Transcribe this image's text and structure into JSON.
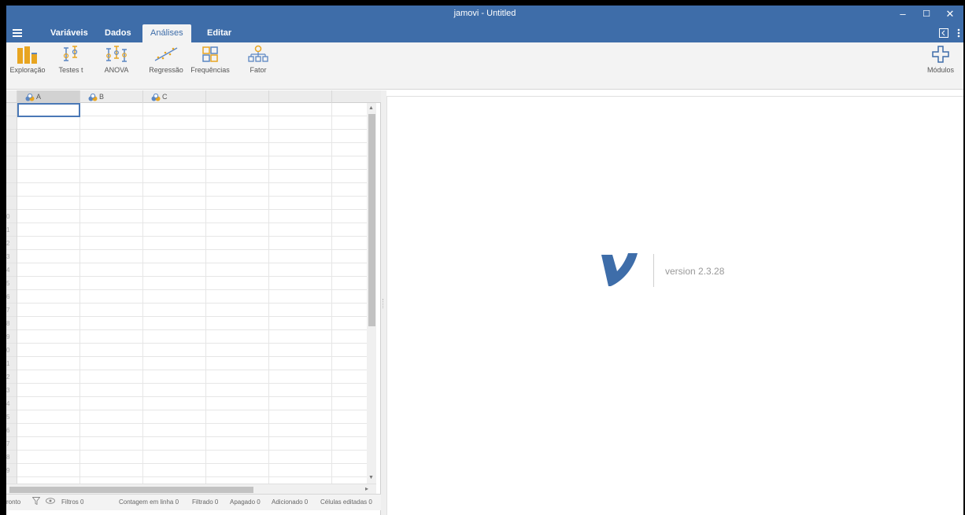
{
  "window": {
    "title": "jamovi - Untitled",
    "controls": {
      "minimize": "–",
      "maximize": "☐",
      "close": "✕"
    }
  },
  "menubar": {
    "tabs": [
      {
        "label": "Variáveis"
      },
      {
        "label": "Dados"
      },
      {
        "label": "Análises",
        "active": true
      },
      {
        "label": "Editar"
      }
    ]
  },
  "ribbon": {
    "buttons": [
      {
        "label": "Exploração",
        "icon": "exploration-icon"
      },
      {
        "label": "Testes t",
        "icon": "ttest-icon"
      },
      {
        "label": "ANOVA",
        "icon": "anova-icon"
      },
      {
        "label": "Regressão",
        "icon": "regression-icon"
      },
      {
        "label": "Frequências",
        "icon": "frequencies-icon"
      },
      {
        "label": "Fator",
        "icon": "factor-icon"
      }
    ],
    "modules_label": "Módulos"
  },
  "grid": {
    "columns": [
      {
        "label": "A"
      },
      {
        "label": "B"
      },
      {
        "label": "C"
      }
    ],
    "row_labels": [
      "",
      "",
      "",
      "",
      "",
      "",
      "",
      "",
      "0",
      "1",
      "2",
      "3",
      "4",
      "5",
      "6",
      "7",
      "8",
      "9",
      "0",
      "1",
      "2",
      "3",
      "4",
      "5",
      "6",
      "7",
      "8",
      "9"
    ]
  },
  "statusbar": {
    "ready": "ronto",
    "filters": "Filtros 0",
    "row_count": "Contagem em linha 0",
    "filtered": "Filtrado 0",
    "deleted": "Apagado 0",
    "added": "Adicionado 0",
    "edited": "Células editadas 0"
  },
  "results": {
    "version": "version 2.3.28"
  },
  "colors": {
    "accent": "#3e6da9",
    "ribbon_icon": "#e8a521"
  }
}
